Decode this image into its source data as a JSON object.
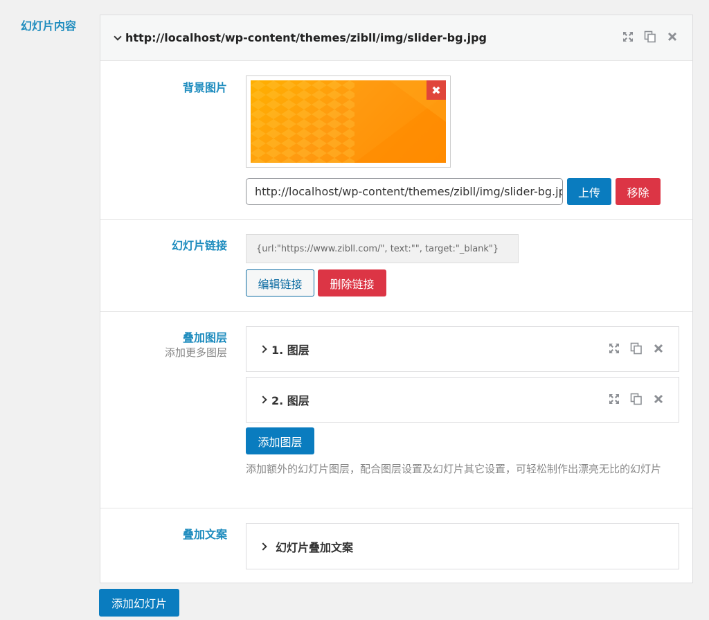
{
  "section_label": "幻灯片内容",
  "slide": {
    "title": "http://localhost/wp-content/themes/zibll/img/slider-bg.jpg",
    "tools": [
      "expand-icon",
      "duplicate-icon",
      "close-icon"
    ]
  },
  "background": {
    "label": "背景图片",
    "remove_image_symbol": "✖",
    "url_value": "http://localhost/wp-content/themes/zibll/img/slider-bg.jpg",
    "upload_label": "上传",
    "remove_label": "移除"
  },
  "link": {
    "label": "幻灯片链接",
    "value": "{url:\"https://www.zibll.com/\", text:\"\", target:\"_blank\"}",
    "edit_label": "编辑链接",
    "delete_label": "删除链接"
  },
  "layers": {
    "label": "叠加图层",
    "sublabel": "添加更多图层",
    "items": [
      {
        "title": "1. 图层"
      },
      {
        "title": "2. 图层"
      }
    ],
    "add_label": "添加图层",
    "description": "添加额外的幻灯片图层，配合图层设置及幻灯片其它设置，可轻松制作出漂亮无比的幻灯片"
  },
  "text_overlay": {
    "label": "叠加文案",
    "item_title": "幻灯片叠加文案"
  },
  "add_slide_label": "添加幻灯片",
  "colors": {
    "accent": "#1e8cbe",
    "primary_button": "#0a7cbf",
    "danger_button": "#dc3545",
    "image_orange": "#ff9a10"
  }
}
